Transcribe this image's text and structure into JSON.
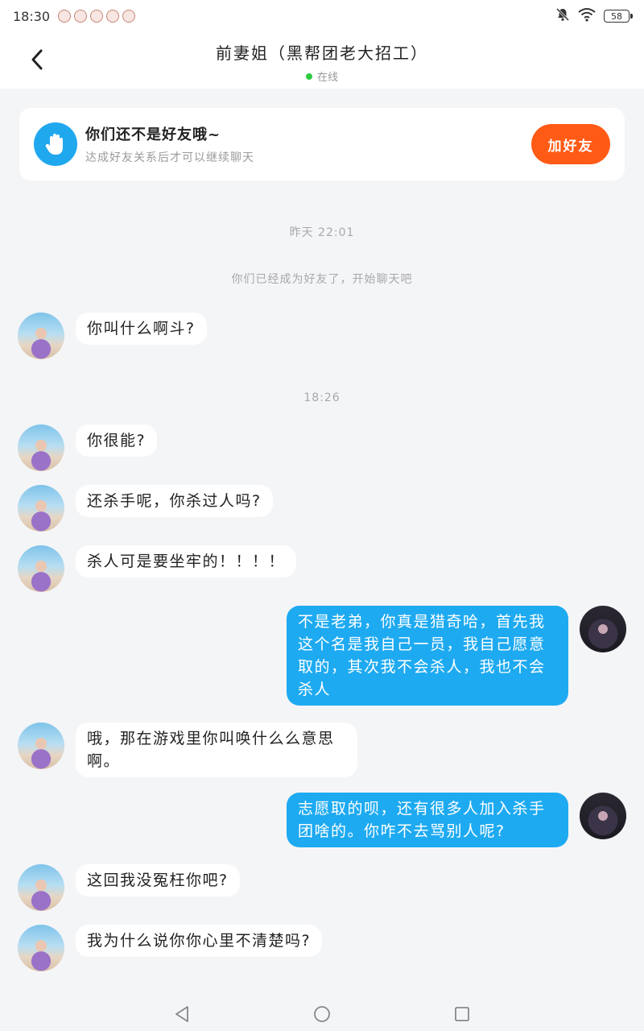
{
  "status_bar": {
    "time": "18:30",
    "notification_icons": [
      "app-notification-icon",
      "app-notification-icon",
      "app-notification-icon",
      "app-notification-icon",
      "app-notification-icon"
    ],
    "battery": "58"
  },
  "header": {
    "title": "前妻姐（黑帮团老大招工）",
    "status": "在线"
  },
  "friend_banner": {
    "title": "你们还不是好友哦~",
    "subtitle": "达成好友关系后才可以继续聊天",
    "button": "加好友"
  },
  "chat": {
    "timestamp_1": "昨天 22:01",
    "system_message": "你们已经成为好友了，开始聊天吧",
    "timestamp_2": "18:26",
    "messages": [
      {
        "from": "other",
        "text": "你叫什么啊斗?"
      },
      {
        "from": "other",
        "text": "你很能?"
      },
      {
        "from": "other",
        "text": "还杀手呢，你杀过人吗?"
      },
      {
        "from": "other",
        "text": "杀人可是要坐牢的！！！！"
      },
      {
        "from": "me",
        "text": "不是老弟，你真是猎奇哈，首先我这个名是我自己一员，我自己愿意取的，其次我不会杀人，我也不会杀人"
      },
      {
        "from": "other",
        "text": "哦，那在游戏里你叫唤什么么意思啊。"
      },
      {
        "from": "me",
        "text": "志愿取的呗，还有很多人加入杀手团啥的。你咋不去骂别人呢?"
      },
      {
        "from": "other",
        "text": "这回我没冤枉你吧?"
      },
      {
        "from": "other",
        "text": "我为什么说你你心里不清楚吗?"
      }
    ]
  },
  "colors": {
    "accent_blue": "#1eaaf1",
    "add_button": "#ff5b16",
    "online": "#2ecc40"
  }
}
